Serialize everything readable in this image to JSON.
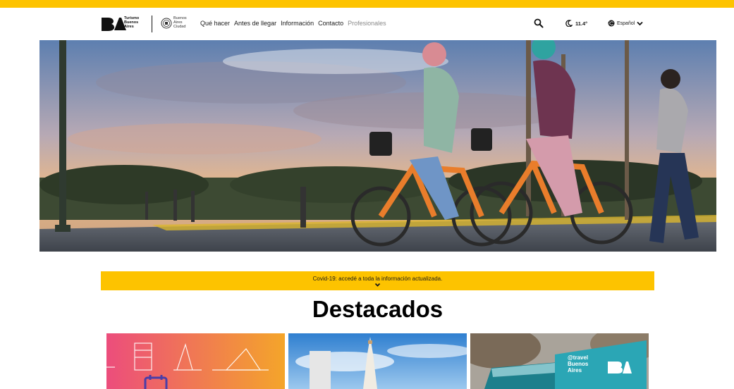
{
  "header": {
    "brand_text_1": "Turismo",
    "brand_text_2": "Buenos",
    "brand_text_3": "Aires",
    "city_text_1": "Buenos",
    "city_text_2": "Aires",
    "city_text_3": "Ciudad",
    "nav": [
      {
        "label": "Qué hacer"
      },
      {
        "label": "Antes de llegar"
      },
      {
        "label": "Información"
      },
      {
        "label": "Contacto"
      },
      {
        "label": "Profesionales"
      }
    ],
    "temperature": "11.4°",
    "language": "Español"
  },
  "banner": {
    "covid_text": "Covid-19: accedé a toda la información actualizada."
  },
  "featured": {
    "title": "Destacados"
  },
  "cards": {
    "truck_line_1": "@travel",
    "truck_line_2": "Buenos",
    "truck_line_3": "Aires"
  },
  "colors": {
    "accent": "#fdc300",
    "text": "#1a1a1a",
    "muted": "#8a8a8a"
  },
  "icons": [
    "search-icon",
    "moon-icon",
    "globe-icon",
    "chevron-down-icon",
    "calendar-icon"
  ]
}
